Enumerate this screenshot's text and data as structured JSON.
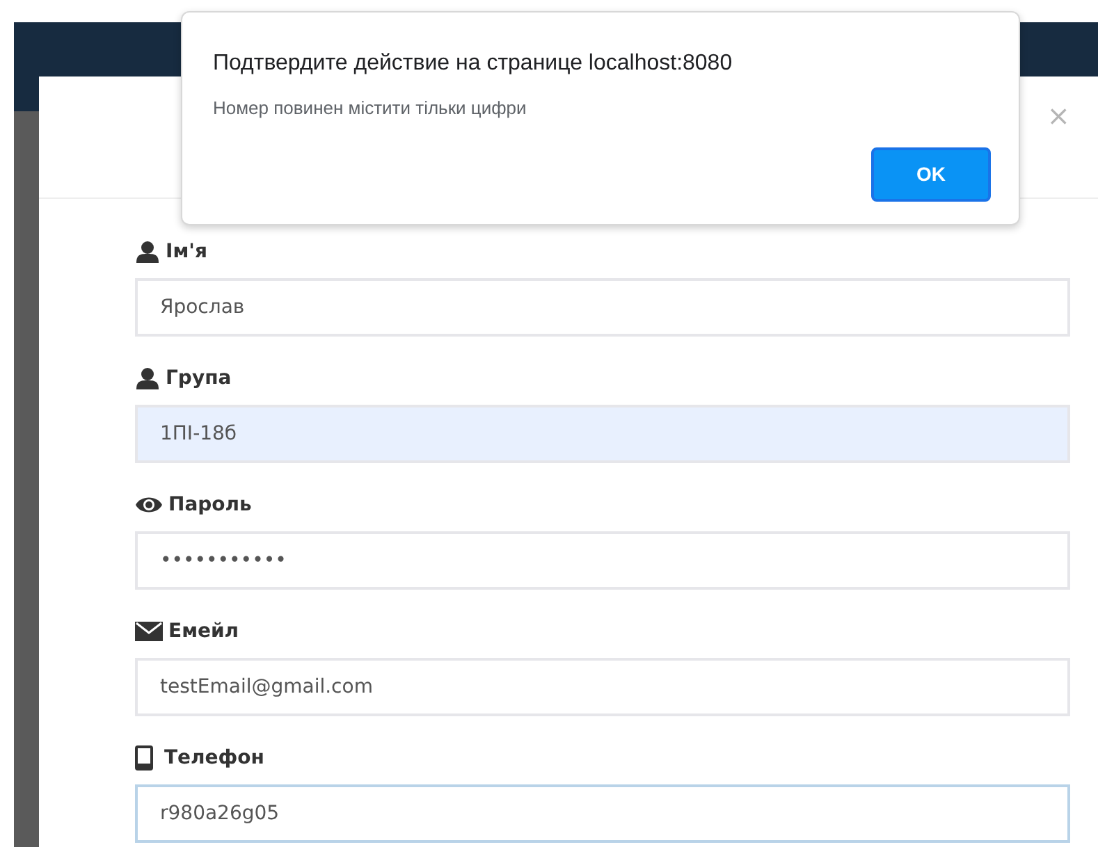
{
  "dialog": {
    "title": "Подтвердите действие на странице localhost:8080",
    "message": "Номер повинен містити тільки цифри",
    "button": "OK"
  },
  "modal": {
    "close": "×"
  },
  "fields": [
    {
      "kind": "user",
      "label": "Ім'я",
      "value": "Ярослав",
      "autofilled": false,
      "focused": false
    },
    {
      "kind": "user",
      "label": "Група",
      "value": "1ПІ-18б",
      "autofilled": true,
      "focused": false
    },
    {
      "kind": "eye",
      "label": "Пароль",
      "value": "•••••••••••",
      "autofilled": false,
      "focused": false
    },
    {
      "kind": "envelope",
      "label": "Емейл",
      "value": "testEmail@gmail.com",
      "autofilled": false,
      "focused": false
    },
    {
      "kind": "phone",
      "label": "Телефон",
      "value": "r980a26g05",
      "autofilled": false,
      "focused": true
    }
  ]
}
